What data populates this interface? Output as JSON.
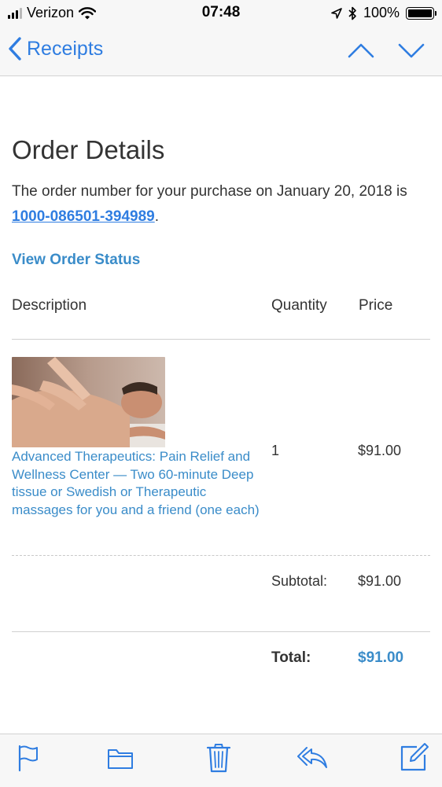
{
  "status_bar": {
    "carrier": "Verizon",
    "time": "07:48",
    "battery": "100%"
  },
  "nav": {
    "back_label": "Receipts"
  },
  "order": {
    "title": "Order Details",
    "intro_text": "The order number for your purchase on January 20, 2018 is ",
    "order_number": "1000-086501-394989",
    "intro_suffix": ".",
    "view_status_label": "View Order Status"
  },
  "table": {
    "headers": {
      "description": "Description",
      "quantity": "Quantity",
      "price": "Price"
    },
    "items": [
      {
        "description": "Advanced Therapeutics: Pain Relief and Wellness Center — Two 60-minute Deep tissue or Swedish or Therapeutic massages for you and a friend (one each)",
        "quantity": "1",
        "price": "$91.00"
      }
    ],
    "subtotal_label": "Subtotal:",
    "subtotal_value": "$91.00",
    "total_label": "Total:",
    "total_value": "$91.00"
  },
  "icons": {
    "back": "chevron-left-icon",
    "prev": "chevron-up-icon",
    "next": "chevron-down-icon",
    "flag": "flag-icon",
    "folder": "folder-icon",
    "trash": "trash-icon",
    "reply": "reply-icon",
    "compose": "compose-icon"
  },
  "colors": {
    "ios_blue": "#2f7de1",
    "link_blue": "#3a8cc9",
    "text": "#333333"
  }
}
